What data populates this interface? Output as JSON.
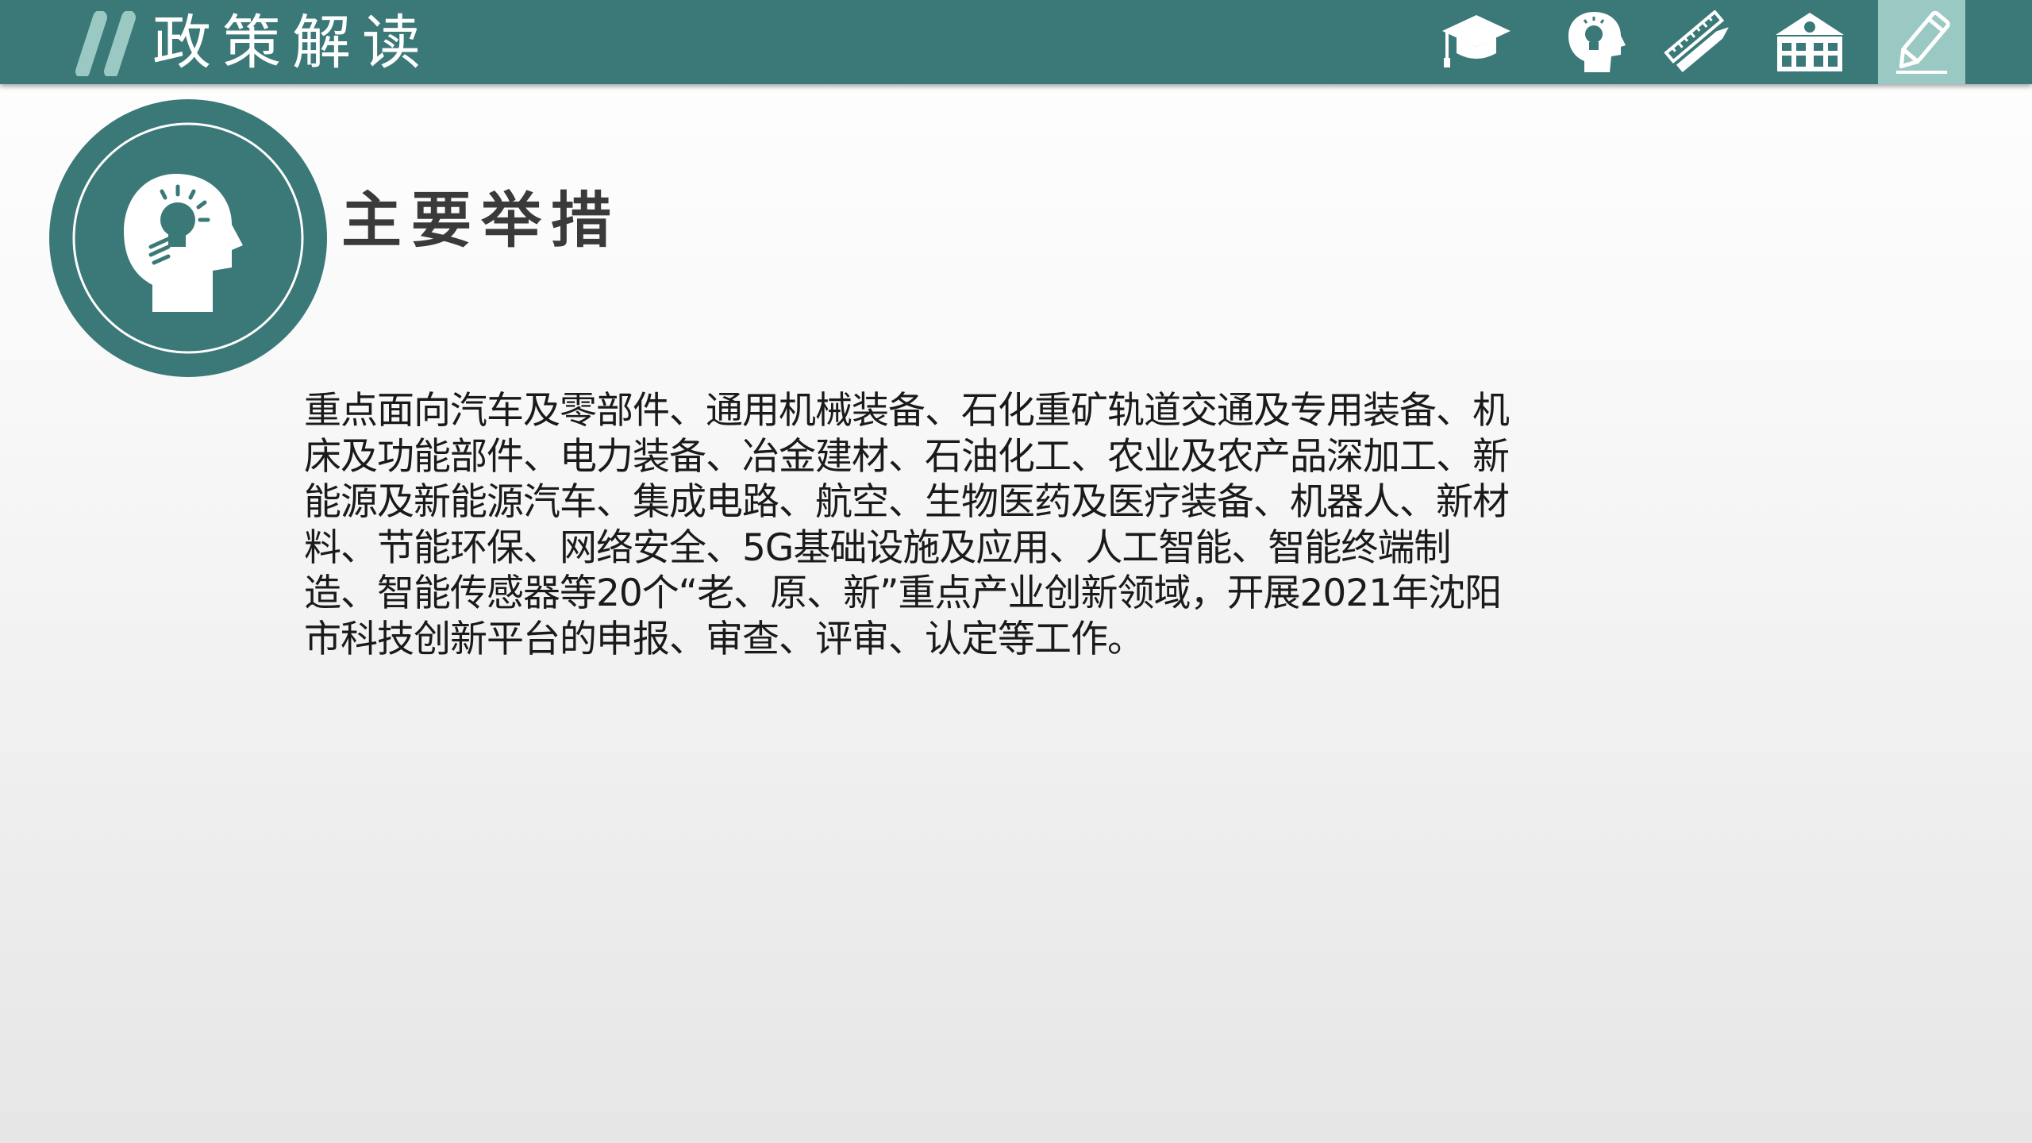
{
  "header": {
    "title": "政策解读",
    "nav": [
      {
        "icon": "graduation-cap-icon",
        "active": false
      },
      {
        "icon": "lightbulb-head-icon",
        "active": false
      },
      {
        "icon": "pencil-ruler-icon",
        "active": false
      },
      {
        "icon": "school-building-icon",
        "active": false
      },
      {
        "icon": "pencil-icon",
        "active": true
      }
    ]
  },
  "section": {
    "icon": "lightbulb-head-icon",
    "title": "主要举措"
  },
  "content": {
    "paragraph": "重点面向汽车及零部件、通用机械装备、石化重矿轨道交通及专用装备、机床及功能部件、电力装备、冶金建材、石油化工、农业及农产品深加工、新能源及新能源汽车、集成电路、航空、生物医药及医疗装备、机器人、新材料、节能环保、网络安全、5G基础设施及应用、人工智能、智能终端制造、智能传感器等20个“老、原、新”重点产业创新领域，开展2021年沈阳市科技创新平台的申报、审查、评审、认定等工作。"
  },
  "colors": {
    "header_bg": "#3b7878",
    "accent_light": "#9ac8c2",
    "badge_teal": "#3b7878",
    "title_text": "#3a3a3a",
    "body_text": "#1a1a1a"
  }
}
